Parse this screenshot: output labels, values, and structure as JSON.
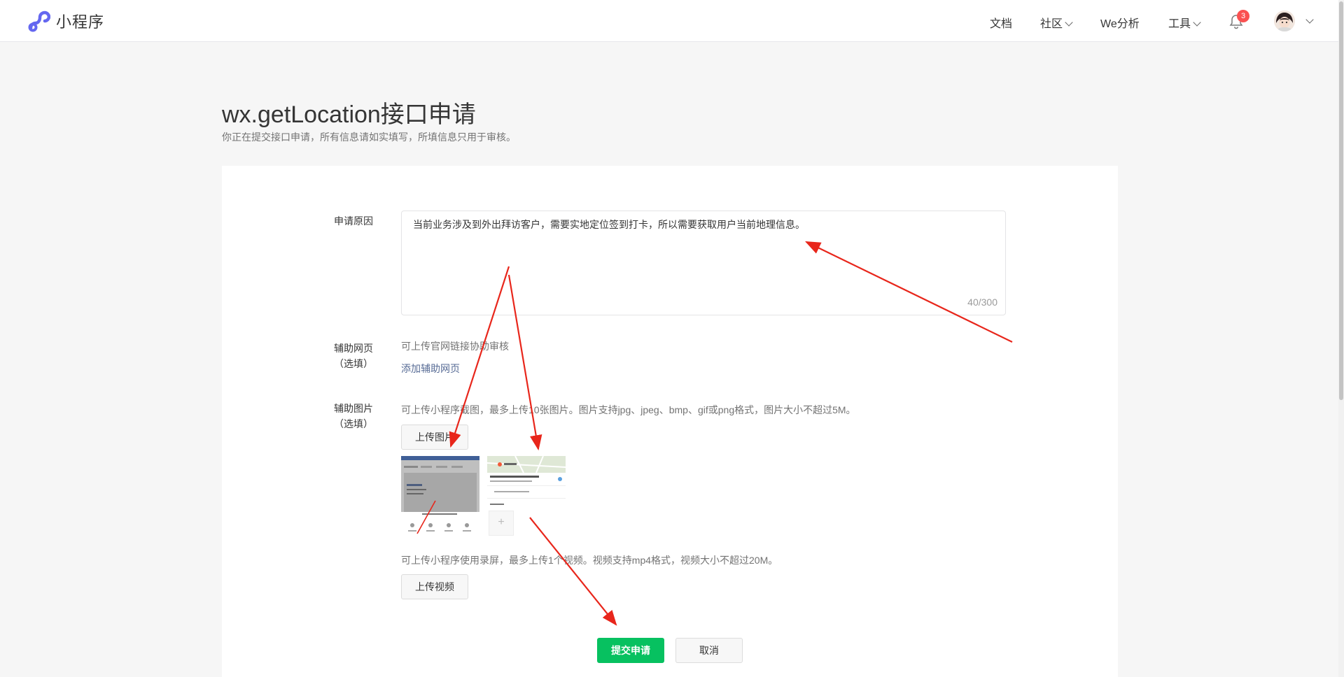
{
  "header": {
    "logo_text": "小程序",
    "nav": [
      "文档",
      "社区",
      "We分析",
      "工具"
    ],
    "notification_count": "3"
  },
  "page": {
    "title": "wx.getLocation接口申请",
    "subtitle": "你正在提交接口申请，所有信息请如实填写，所填信息只用于审核。"
  },
  "form": {
    "reason": {
      "label": "申请原因",
      "value": "当前业务涉及到外出拜访客户，需要实地定位签到打卡，所以需要获取用户当前地理信息。",
      "counter": "40/300"
    },
    "webpage": {
      "label_line1": "辅助网页",
      "label_line2": "（选填）",
      "tip": "可上传官网链接协助审核",
      "add_link": "添加辅助网页"
    },
    "images": {
      "label_line1": "辅助图片",
      "label_line2": "（选填）",
      "tip": "可上传小程序截图，最多上传10张图片。图片支持jpg、jpeg、bmp、gif或png格式，图片大小不超过5M。",
      "upload_label": "上传图片",
      "thumbnails": [
        "screenshot-1",
        "screenshot-2"
      ]
    },
    "video": {
      "tip": "可上传小程序使用录屏，最多上传1个视频。视频支持mp4格式，视频大小不超过20M。",
      "upload_label": "上传视频"
    },
    "submit_label": "提交申请",
    "cancel_label": "取消"
  },
  "colors": {
    "primary": "#07c160",
    "link": "#576b95",
    "badge": "#fa5151",
    "arrow": "#e8261b"
  }
}
